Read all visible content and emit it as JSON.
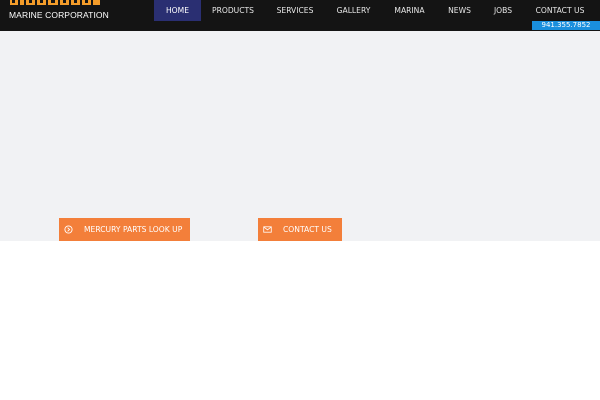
{
  "logo": {
    "company_line": "MARINE CORPORATION",
    "accent_color": "#f39c2a"
  },
  "nav": {
    "items": [
      {
        "label": "HOME",
        "active": true
      },
      {
        "label": "PRODUCTS",
        "active": false
      },
      {
        "label": "SERVICES",
        "active": false
      },
      {
        "label": "GALLERY",
        "active": false
      },
      {
        "label": "MARINA",
        "active": false
      },
      {
        "label": "NEWS",
        "active": false
      },
      {
        "label": "JOBS",
        "active": false
      },
      {
        "label": "CONTACT US",
        "active": false
      }
    ],
    "active_color": "#2a2f72"
  },
  "header": {
    "phone": "941.355.7852",
    "phone_color": "#1a8fdd"
  },
  "cta": {
    "parts_label": "MERCURY PARTS LOOK UP",
    "parts_icon": "arrow-circle-icon",
    "contact_label": "CONTACT US",
    "contact_icon": "envelope-icon",
    "color": "#f37f3a"
  }
}
